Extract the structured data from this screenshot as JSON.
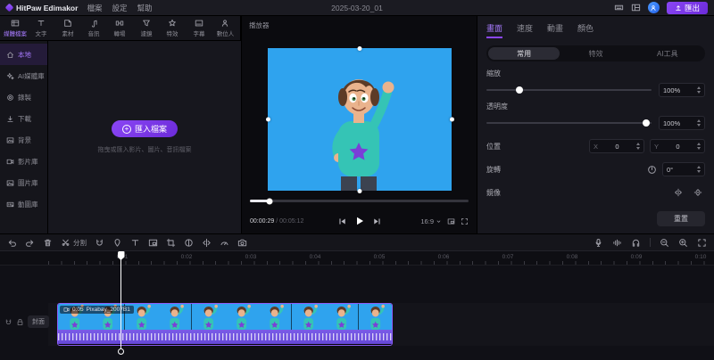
{
  "topbar": {
    "logo_text": "HitPaw Edimakor",
    "menus": [
      "檔案",
      "設定",
      "幫助"
    ],
    "project_title": "2025-03-20_01",
    "export_label": "匯出"
  },
  "ribbon": {
    "items": [
      {
        "label": "媒體檔案",
        "icon": "media",
        "active": true
      },
      {
        "label": "文字",
        "icon": "text"
      },
      {
        "label": "素材",
        "icon": "sticker"
      },
      {
        "label": "音訊",
        "icon": "audio"
      },
      {
        "label": "轉場",
        "icon": "transition"
      },
      {
        "label": "濾鏡",
        "icon": "filter"
      },
      {
        "label": "特效",
        "icon": "effects"
      },
      {
        "label": "字幕",
        "icon": "subtitle"
      },
      {
        "label": "數位人",
        "icon": "digital-human"
      }
    ]
  },
  "sidebar": {
    "items": [
      {
        "label": "本地",
        "icon": "local",
        "active": true
      },
      {
        "label": "AI媒體庫",
        "icon": "ai-media"
      },
      {
        "label": "錄製",
        "icon": "record"
      },
      {
        "label": "下載",
        "icon": "download"
      },
      {
        "label": "背景",
        "icon": "background"
      },
      {
        "label": "影片庫",
        "icon": "video-library"
      },
      {
        "label": "圖片庫",
        "icon": "image-library"
      },
      {
        "label": "動圖庫",
        "icon": "gif-library"
      }
    ]
  },
  "import_panel": {
    "button_label": "匯入檔案",
    "hint": "拖曳或匯入影片、圖片、音訊檔案"
  },
  "player": {
    "panel_label": "播放器",
    "current_time": "00:00:29",
    "time_separator": " / ",
    "total_time": "00:05:12",
    "aspect_ratio": "16:9",
    "progress_percent": 9
  },
  "properties": {
    "tabs": [
      {
        "label": "畫面",
        "active": true
      },
      {
        "label": "速度"
      },
      {
        "label": "動畫"
      },
      {
        "label": "顏色"
      }
    ],
    "subtabs": [
      {
        "label": "常用",
        "active": true
      },
      {
        "label": "特效"
      },
      {
        "label": "AI工具"
      }
    ],
    "scale": {
      "label": "縮放",
      "value": "100%",
      "slider_percent": 20
    },
    "opacity": {
      "label": "透明度",
      "value": "100%",
      "slider_percent": 97
    },
    "position": {
      "label": "位置",
      "x_label": "X",
      "x_value": "0",
      "y_label": "Y",
      "y_value": "0"
    },
    "rotate": {
      "label": "旋轉",
      "value": "0°"
    },
    "mirror": {
      "label": "鏡像"
    },
    "reset_label": "重置"
  },
  "timeline": {
    "toolbar": {
      "split_label": "分割"
    },
    "ruler_labels": [
      "0:01",
      "0:02",
      "0:03",
      "0:04",
      "0:05",
      "0:06",
      "0:07",
      "0:08",
      "0:09",
      "0:10"
    ],
    "cover_label": "封面",
    "clip": {
      "duration": "0:05",
      "name": "Pixabay_2007B1"
    }
  },
  "colors": {
    "accent": "#7b3ff2",
    "preview_background": "#2fa3ee",
    "clip_border": "#8b5cf6",
    "waveform": "#6f52e0"
  }
}
